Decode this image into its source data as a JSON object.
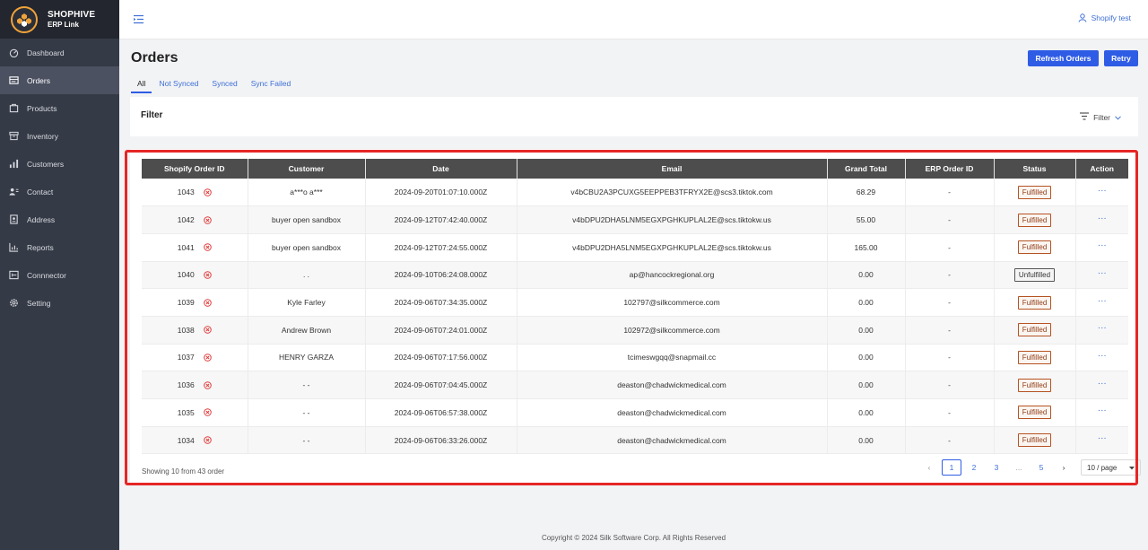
{
  "brand": {
    "name": "SHOPHIVE",
    "sub": "ERP Link"
  },
  "sidebar": {
    "items": [
      {
        "label": "Dashboard",
        "icon": "dashboard-icon"
      },
      {
        "label": "Orders",
        "icon": "orders-icon",
        "active": true
      },
      {
        "label": "Products",
        "icon": "products-icon"
      },
      {
        "label": "Inventory",
        "icon": "inventory-icon"
      },
      {
        "label": "Customers",
        "icon": "customers-icon"
      },
      {
        "label": "Contact",
        "icon": "contact-icon"
      },
      {
        "label": "Address",
        "icon": "address-icon"
      },
      {
        "label": "Reports",
        "icon": "reports-icon"
      },
      {
        "label": "Connnector",
        "icon": "connector-icon"
      },
      {
        "label": "Setting",
        "icon": "setting-icon"
      }
    ]
  },
  "header": {
    "user": "Shopify test"
  },
  "page": {
    "title": "Orders",
    "refresh_label": "Refresh Orders",
    "retry_label": "Retry",
    "tabs": [
      "All",
      "Not Synced",
      "Synced",
      "Sync Failed"
    ],
    "active_tab": "All"
  },
  "filter": {
    "title": "Filter",
    "button_label": "Filter"
  },
  "table": {
    "columns": [
      "Shopify Order ID",
      "Customer",
      "Date",
      "Email",
      "Grand Total",
      "ERP Order ID",
      "Status",
      "Action"
    ],
    "rows": [
      {
        "id": "1043",
        "customer": "a***o a***",
        "date": "2024-09-20T01:07:10.000Z",
        "email": "v4bCBU2A3PCUXG5EEPPEB3TFRYX2E@scs3.tiktok.com",
        "total": "68.29",
        "erp": "-",
        "status": "Fulfilled"
      },
      {
        "id": "1042",
        "customer": "buyer open sandbox",
        "date": "2024-09-12T07:42:40.000Z",
        "email": "v4bDPU2DHA5LNM5EGXPGHKUPLAL2E@scs.tiktokw.us",
        "total": "55.00",
        "erp": "-",
        "status": "Fulfilled"
      },
      {
        "id": "1041",
        "customer": "buyer open sandbox",
        "date": "2024-09-12T07:24:55.000Z",
        "email": "v4bDPU2DHA5LNM5EGXPGHKUPLAL2E@scs.tiktokw.us",
        "total": "165.00",
        "erp": "-",
        "status": "Fulfilled"
      },
      {
        "id": "1040",
        "customer": ". .",
        "date": "2024-09-10T06:24:08.000Z",
        "email": "ap@hancockregional.org",
        "total": "0.00",
        "erp": "-",
        "status": "Unfulfilled"
      },
      {
        "id": "1039",
        "customer": "Kyle Farley",
        "date": "2024-09-06T07:34:35.000Z",
        "email": "102797@silkcommerce.com",
        "total": "0.00",
        "erp": "-",
        "status": "Fulfilled"
      },
      {
        "id": "1038",
        "customer": "Andrew Brown",
        "date": "2024-09-06T07:24:01.000Z",
        "email": "102972@silkcommerce.com",
        "total": "0.00",
        "erp": "-",
        "status": "Fulfilled"
      },
      {
        "id": "1037",
        "customer": "HENRY GARZA",
        "date": "2024-09-06T07:17:56.000Z",
        "email": "tcimeswgqq@snapmail.cc",
        "total": "0.00",
        "erp": "-",
        "status": "Fulfilled"
      },
      {
        "id": "1036",
        "customer": "- -",
        "date": "2024-09-06T07:04:45.000Z",
        "email": "deaston@chadwickmedical.com",
        "total": "0.00",
        "erp": "-",
        "status": "Fulfilled"
      },
      {
        "id": "1035",
        "customer": "- -",
        "date": "2024-09-06T06:57:38.000Z",
        "email": "deaston@chadwickmedical.com",
        "total": "0.00",
        "erp": "-",
        "status": "Fulfilled"
      },
      {
        "id": "1034",
        "customer": "- -",
        "date": "2024-09-06T06:33:26.000Z",
        "email": "deaston@chadwickmedical.com",
        "total": "0.00",
        "erp": "-",
        "status": "Fulfilled"
      }
    ],
    "action_label": "···"
  },
  "pagination": {
    "showing": "Showing 10 from 43 order",
    "pages": [
      "1",
      "2",
      "3",
      "...",
      "5"
    ],
    "current": "1",
    "page_size": "10 / page"
  },
  "footer": {
    "copyright": "Copyright © 2024 Silk Software Corp. All Rights Reserved"
  },
  "colors": {
    "primary": "#2f5ce5",
    "sidebar": "#343a46",
    "highlight": "#e52626",
    "error": "#e03a3a",
    "fulfilled": "#b55322"
  }
}
